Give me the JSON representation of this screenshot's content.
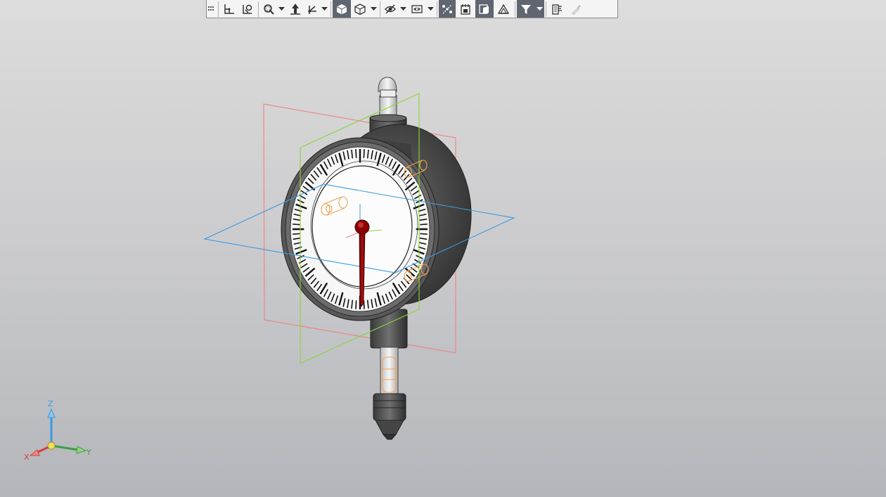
{
  "toolbar": {
    "buttons": [
      {
        "name": "toolbar-grip-icon"
      },
      {
        "name": "sketch-icon"
      },
      {
        "name": "parameters-icon"
      },
      {
        "name": "zoom-window-icon"
      },
      {
        "name": "pan-icon"
      },
      {
        "name": "rotate-icon"
      },
      {
        "name": "orientation-icon",
        "active": true
      },
      {
        "name": "display-style-icon"
      },
      {
        "name": "hide-icon"
      },
      {
        "name": "view-mode-icon"
      },
      {
        "name": "constraints-icon",
        "active": true
      },
      {
        "name": "section-icon"
      },
      {
        "name": "display-icon",
        "active": true
      },
      {
        "name": "perspective-icon"
      },
      {
        "name": "filter-icon",
        "active": true
      },
      {
        "name": "properties-icon"
      },
      {
        "name": "eyedropper-icon",
        "disabled": true
      }
    ]
  },
  "axes": {
    "x": "X",
    "y": "Y",
    "z": "Z"
  },
  "colors": {
    "plane_front": "#f08080",
    "plane_side": "#8ad43a",
    "plane_top": "#3a9ae0",
    "needle": "#8b0000",
    "hidden_parts": "#f0a050",
    "body": "#4a4a4a"
  }
}
